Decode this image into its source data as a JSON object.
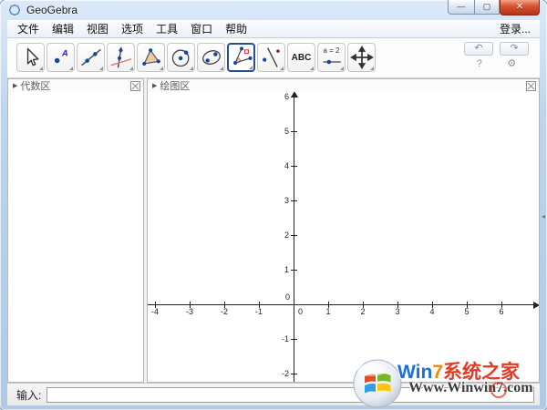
{
  "window": {
    "title": "GeoGebra",
    "minimize_icon": "—",
    "maximize_icon": "▢",
    "close_icon": "✕"
  },
  "menu": {
    "items": [
      "文件",
      "编辑",
      "视图",
      "选项",
      "工具",
      "窗口",
      "帮助"
    ],
    "login_label": "登录..."
  },
  "toolbar": {
    "tools": [
      {
        "name": "move",
        "selected": false
      },
      {
        "name": "point",
        "selected": false
      },
      {
        "name": "line",
        "selected": false
      },
      {
        "name": "perpendicular-line",
        "selected": false
      },
      {
        "name": "polygon",
        "selected": false
      },
      {
        "name": "circle",
        "selected": false
      },
      {
        "name": "ellipse",
        "selected": false
      },
      {
        "name": "angle",
        "selected": true
      },
      {
        "name": "reflect",
        "selected": false
      },
      {
        "name": "text",
        "glyph": "ABC",
        "selected": false
      },
      {
        "name": "slider",
        "glyph": "a = 2",
        "selected": false
      },
      {
        "name": "move-view",
        "selected": false
      }
    ],
    "undo_icon": "↶",
    "redo_icon": "↷",
    "help_icon": "?",
    "settings_icon": "⚙"
  },
  "panels": {
    "algebra": {
      "title": "代数区",
      "collapse_icon": "▶"
    },
    "graphics": {
      "title": "绘图区",
      "collapse_icon": "▶"
    }
  },
  "graph": {
    "x_ticks": [
      -4,
      -3,
      -2,
      -1,
      0,
      1,
      2,
      3,
      4,
      5,
      6
    ],
    "y_ticks": [
      -2,
      -1,
      0,
      1,
      2,
      3,
      4,
      5,
      6
    ],
    "x_range": [
      -4.3,
      7.0
    ],
    "y_range": [
      -2.5,
      6.3
    ]
  },
  "input_bar": {
    "label": "输入:",
    "value": ""
  },
  "side_toggle_icon": "◂",
  "watermark": {
    "brand_win": "Win",
    "brand_seven": "7",
    "brand_rest": "系统之家",
    "url": "Www.Winwin7.com"
  }
}
